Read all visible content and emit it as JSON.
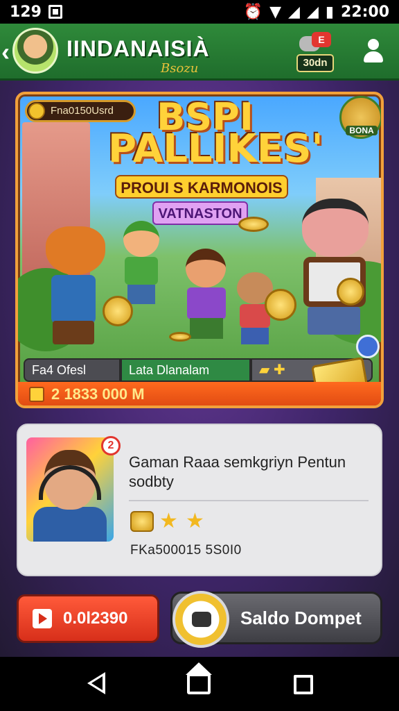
{
  "status_bar": {
    "left_time": "129",
    "clock": "22:00",
    "icons": [
      "app-notification-icon",
      "alarm-icon",
      "wifi-icon",
      "signal-icon",
      "signal-icon",
      "battery-icon"
    ]
  },
  "header": {
    "title": "IINDANAISIÀ",
    "subtitle": "Bsozu",
    "chat_badge": "E",
    "score_badge": "30dn",
    "colors": {
      "bar": "#2f8a3a",
      "accent": "#e9c23a"
    }
  },
  "banner": {
    "coin_chip": "Fna0150Usrd",
    "title_line1": "BSPI",
    "title_line2": "PALLIKES'",
    "subtitle": "PROUI S KARMONOIS",
    "tag": "VATNASTON",
    "level_badge": "BONA",
    "tabs": [
      "Fa4 Ofesl",
      "Lata Dlanalam",
      ""
    ],
    "footer_amount": "2 1833 000 M"
  },
  "info_card": {
    "notification_count": "2",
    "title": "Gaman Raaa semkgriyn Pentun sodbty",
    "code": "FKa500015 5S0I0"
  },
  "buttons": {
    "play_label": "0.0l2390",
    "wallet_label": "Saldo Dompet"
  },
  "navbar": {
    "icons": [
      "back-icon",
      "home-icon",
      "recent-apps-icon"
    ]
  }
}
